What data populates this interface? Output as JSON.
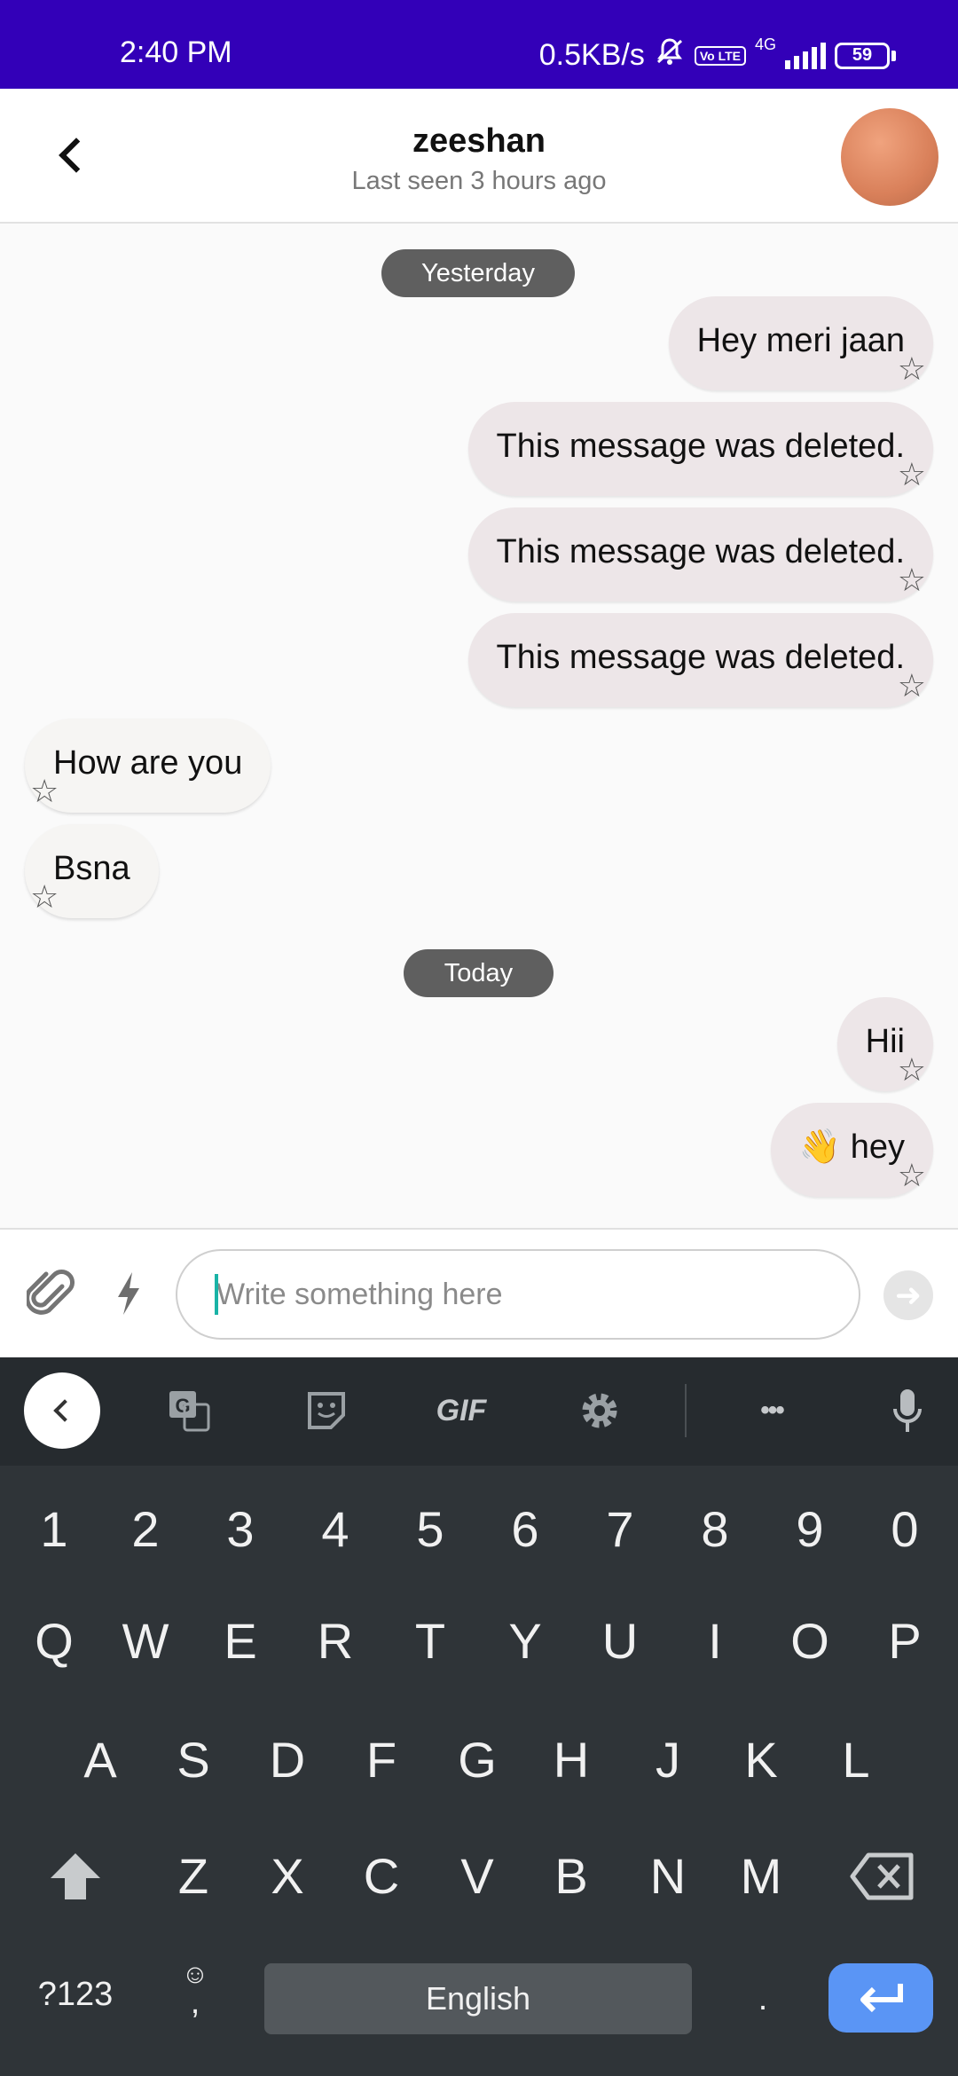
{
  "status_bar": {
    "time": "2:40 PM",
    "speed": "0.5KB/s",
    "volte": "Vo LTE",
    "network": "4G",
    "battery": "59"
  },
  "header": {
    "name": "zeeshan",
    "last_seen": "Last seen 3 hours ago"
  },
  "messages": {
    "date_yesterday": "Yesterday",
    "date_today": "Today",
    "m1": "Hey meri jaan",
    "m2": "This message was deleted.",
    "m3": "This message was deleted.",
    "m4": "This message was deleted.",
    "m5": "How are you",
    "m6": "Bsna",
    "m7": "Hii",
    "m8": "👋 hey"
  },
  "composer": {
    "placeholder": "Write something here"
  },
  "keyboard": {
    "number_row": [
      "1",
      "2",
      "3",
      "4",
      "5",
      "6",
      "7",
      "8",
      "9",
      "0"
    ],
    "row1": [
      "Q",
      "W",
      "E",
      "R",
      "T",
      "Y",
      "U",
      "I",
      "O",
      "P"
    ],
    "row2": [
      "A",
      "S",
      "D",
      "F",
      "G",
      "H",
      "J",
      "K",
      "L"
    ],
    "row3": [
      "Z",
      "X",
      "C",
      "V",
      "B",
      "N",
      "M"
    ],
    "symbols_key": "?123",
    "comma_key": ",",
    "space_label": "English",
    "period_key": ".",
    "gif_label": "GIF",
    "more_label": "•••"
  },
  "colors": {
    "status_bar": "#3300b8",
    "outgoing_bubble": "#ede6e8",
    "incoming_bubble": "#f6f5f3",
    "enter_key": "#5a95f5"
  }
}
